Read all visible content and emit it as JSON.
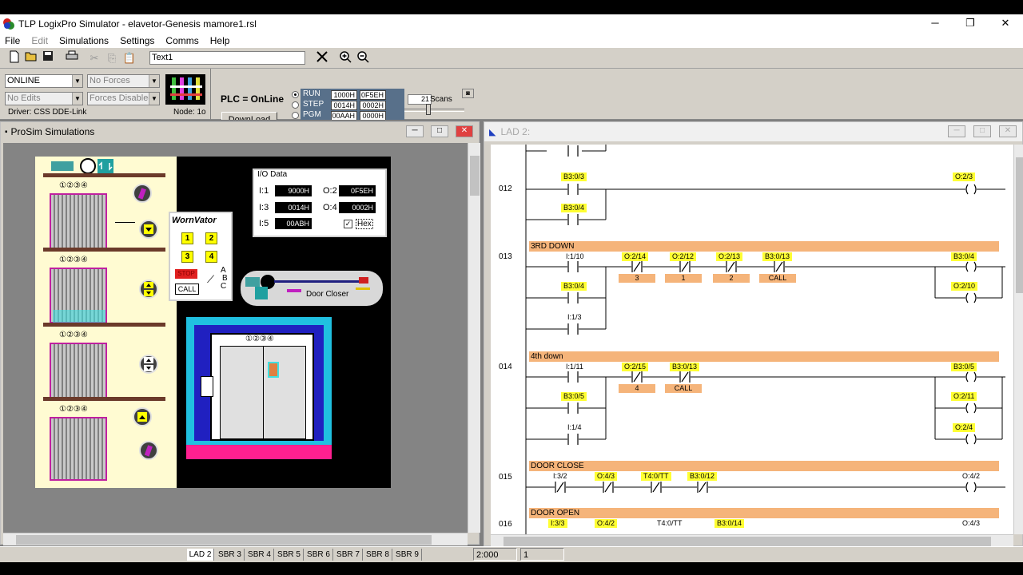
{
  "window": {
    "title": "TLP LogixPro Simulator  -  elavetor-Genesis mamore1.rsl",
    "minimize": "─",
    "restore": "❐",
    "close": "✕"
  },
  "menu": [
    "File",
    "Edit",
    "Simulations",
    "Settings",
    "Comms",
    "Help"
  ],
  "toolbar": {
    "text_field": "Text1"
  },
  "status": {
    "mode_select": "ONLINE",
    "forces_select": "No Forces",
    "edits_select": "No Edits",
    "forces_state_select": "Forces Disabled",
    "driver": "Driver: CSS DDE-Link",
    "node": "Node: 1o",
    "plc_state": "PLC = OnLine",
    "download_label": "DownLoad",
    "run_label": "RUN",
    "step_label": "STEP",
    "pgm_label": "PGM",
    "lcd_r1c1": "1000H",
    "lcd_r1c2": "0F5EH",
    "lcd_r2c1": "0014H",
    "lcd_r2c2": "0002H",
    "lcd_r3c1": "00AAH",
    "lcd_r3c2": "0000H",
    "scans_value": "21",
    "scans_label": "Scans"
  },
  "prosim": {
    "title": "ProSim Simulations",
    "io_title": "I/O Data",
    "io": [
      {
        "label": "I:1",
        "value": "9000H"
      },
      {
        "label": "O:2",
        "value": "0F5EH"
      },
      {
        "label": "I:3",
        "value": "0014H"
      },
      {
        "label": "O:4",
        "value": "0002H"
      },
      {
        "label": "I:5",
        "value": "00ABH"
      }
    ],
    "hex_label": "Hex",
    "wornvator": "WornVator",
    "keys": [
      "1",
      "2",
      "3",
      "4"
    ],
    "stop_label": "STOP",
    "call_label": "CALL",
    "abc_a": "A",
    "abc_b": "B",
    "abc_c": "C",
    "door_closer": "Door Closer",
    "floor_numbers": "①②③④"
  },
  "lad": {
    "title": "LAD 2:",
    "rungs": [
      {
        "num": "012",
        "title": ""
      },
      {
        "num": "013",
        "title": "3RD DOWN"
      },
      {
        "num": "014",
        "title": "4th down"
      },
      {
        "num": "015",
        "title": "DOOR CLOSE"
      },
      {
        "num": "016",
        "title": "DOOR OPEN"
      }
    ],
    "r12": {
      "c1": "B3:0/3",
      "c2": "B3:0/4",
      "out": "O:2/3"
    },
    "r13": {
      "main": "I:1/10",
      "nc1": "O:2/14",
      "nc1_lab": "3",
      "nc2": "O:2/12",
      "nc2_lab": "1",
      "nc3": "O:2/13",
      "nc3_lab": "2",
      "nc4": "B3:0/13",
      "nc4_lab": "CALL",
      "br1": "B3:0/4",
      "br2": "I:1/3",
      "out1": "B3:0/4",
      "out2": "O:2/10"
    },
    "r14": {
      "main": "I:1/11",
      "nc1": "O:2/15",
      "nc1_lab": "4",
      "nc2": "B3:0/13",
      "nc2_lab": "CALL",
      "br1": "B3:0/5",
      "br2": "I:1/4",
      "out1": "B3:0/5",
      "out2": "O:2/11",
      "out3": "O:2/4"
    },
    "r15": {
      "c1": "I:3/2",
      "c2": "O:4/3",
      "c3": "T4:0/TT",
      "c4": "B3:0/12",
      "out": "O:4/2"
    },
    "r16": {
      "c1": "I:3/3",
      "c2": "O:4/2",
      "c3": "T4:0/TT",
      "c4": "B3:0/14",
      "out": "O:4/3"
    }
  },
  "tabs": [
    "LAD 2",
    "SBR 3",
    "SBR 4",
    "SBR 5",
    "SBR 6",
    "SBR 7",
    "SBR 8",
    "SBR 9"
  ],
  "statusbar": {
    "pos": "2:000",
    "field2": "1"
  }
}
